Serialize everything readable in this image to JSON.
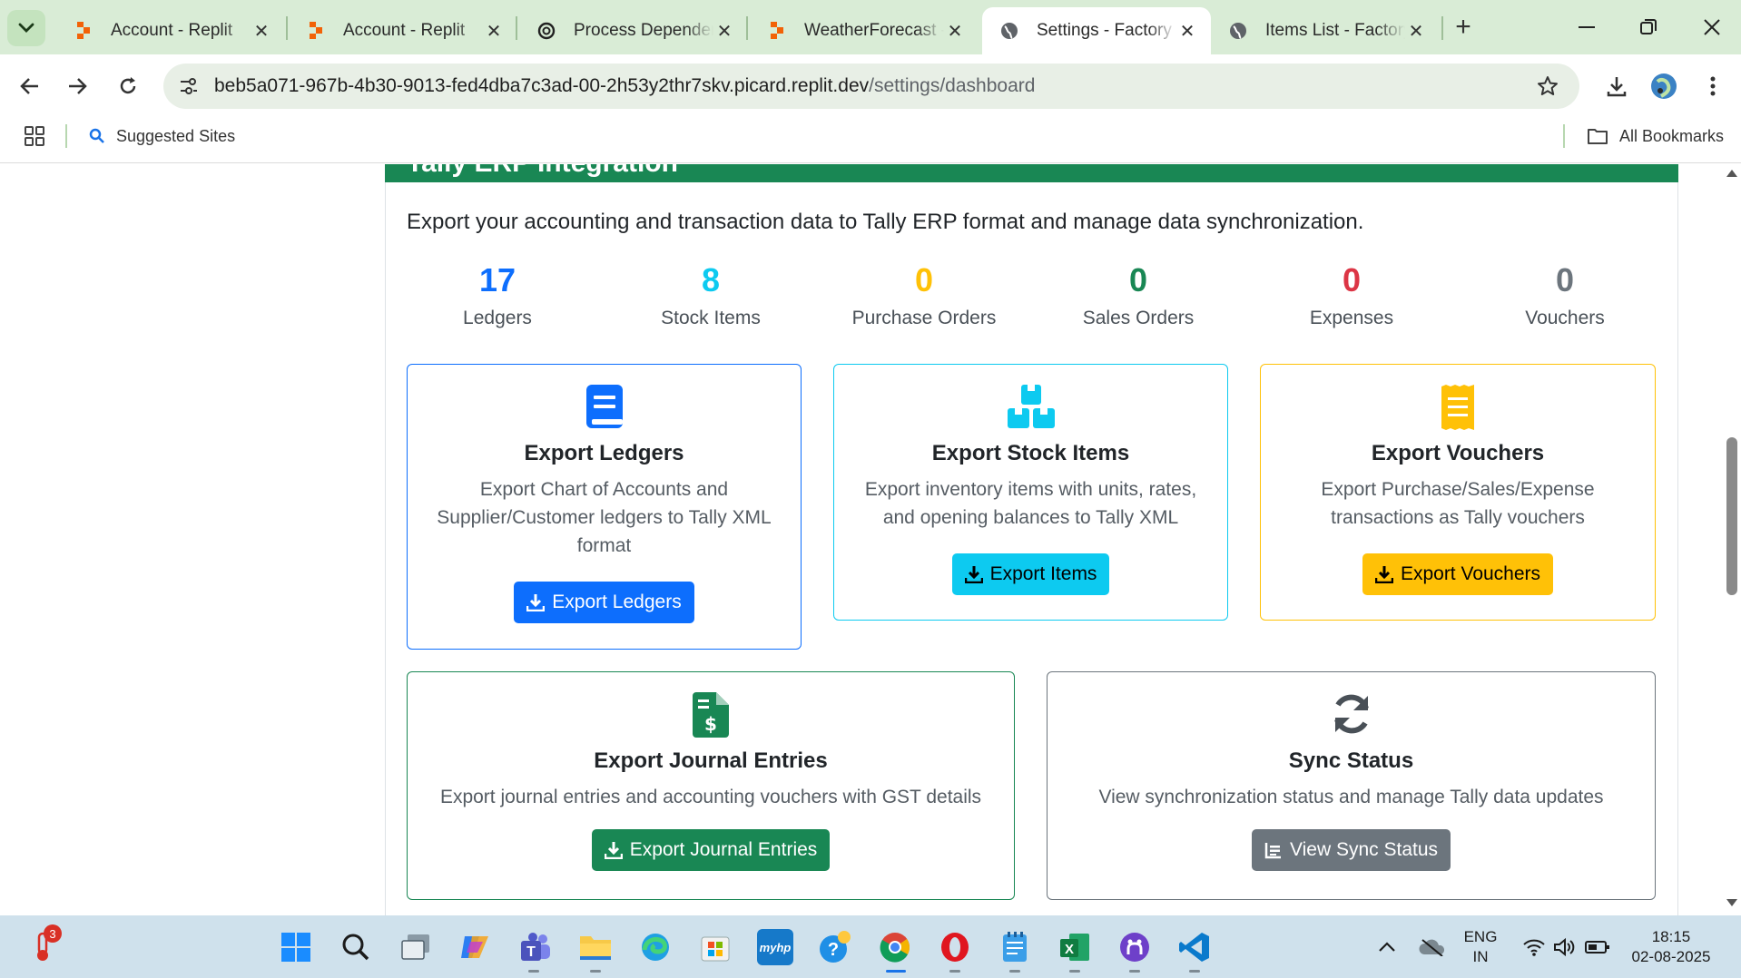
{
  "browser": {
    "tabs": [
      {
        "title": "Account - Replit",
        "icon": "replit-icon",
        "active": false
      },
      {
        "title": "Account - Replit",
        "icon": "replit-icon",
        "active": false
      },
      {
        "title": "Process Dependen",
        "icon": "openai-icon",
        "active": false
      },
      {
        "title": "WeatherForecast -",
        "icon": "replit-icon",
        "active": false
      },
      {
        "title": "Settings - Factory",
        "icon": "globe-icon",
        "active": true
      },
      {
        "title": "Items List - Factory",
        "icon": "globe-icon",
        "active": false
      }
    ],
    "url_host": "beb5a071-967b-4b30-9013-fed4dba7c3ad-00-2h53y2thr7skv.picard.replit.dev",
    "url_path": "/settings/dashboard",
    "bookmarks": {
      "suggested": "Suggested Sites",
      "all": "All Bookmarks"
    }
  },
  "page": {
    "header_title": "Tally ERP Integration",
    "description": "Export your accounting and transaction data to Tally ERP format and manage data synchronization.",
    "stats": [
      {
        "value": "17",
        "label": "Ledgers",
        "color": "#0d6efd"
      },
      {
        "value": "8",
        "label": "Stock Items",
        "color": "#0dcaf0"
      },
      {
        "value": "0",
        "label": "Purchase Orders",
        "color": "#ffc107"
      },
      {
        "value": "0",
        "label": "Sales Orders",
        "color": "#198754"
      },
      {
        "value": "0",
        "label": "Expenses",
        "color": "#dc3545"
      },
      {
        "value": "0",
        "label": "Vouchers",
        "color": "#6c757d"
      }
    ],
    "cards": {
      "ledgers": {
        "title": "Export Ledgers",
        "text": "Export Chart of Accounts and Supplier/Customer ledgers to Tally XML format",
        "button": "Export Ledgers",
        "color": "#0d6efd",
        "icon": "book-icon"
      },
      "stock": {
        "title": "Export Stock Items",
        "text": "Export inventory items with units, rates, and opening balances to Tally XML",
        "button": "Export Items",
        "color": "#0dcaf0",
        "icon": "boxes-icon"
      },
      "vouchers": {
        "title": "Export Vouchers",
        "text": "Export Purchase/Sales/Expense transactions as Tally vouchers",
        "button": "Export Vouchers",
        "color": "#ffc107",
        "icon": "receipt-icon"
      },
      "journal": {
        "title": "Export Journal Entries",
        "text": "Export journal entries and accounting vouchers with GST details",
        "button": "Export Journal Entries",
        "color": "#198754",
        "icon": "invoice-dollar-icon"
      },
      "sync": {
        "title": "Sync Status",
        "text": "View synchronization status and manage Tally data updates",
        "button": "View Sync Status",
        "color": "#6c757d",
        "icon": "sync-icon"
      }
    }
  },
  "taskbar": {
    "notification_badge": "3",
    "language": "ENG",
    "region": "IN",
    "time": "18:15",
    "date": "02-08-2025"
  }
}
